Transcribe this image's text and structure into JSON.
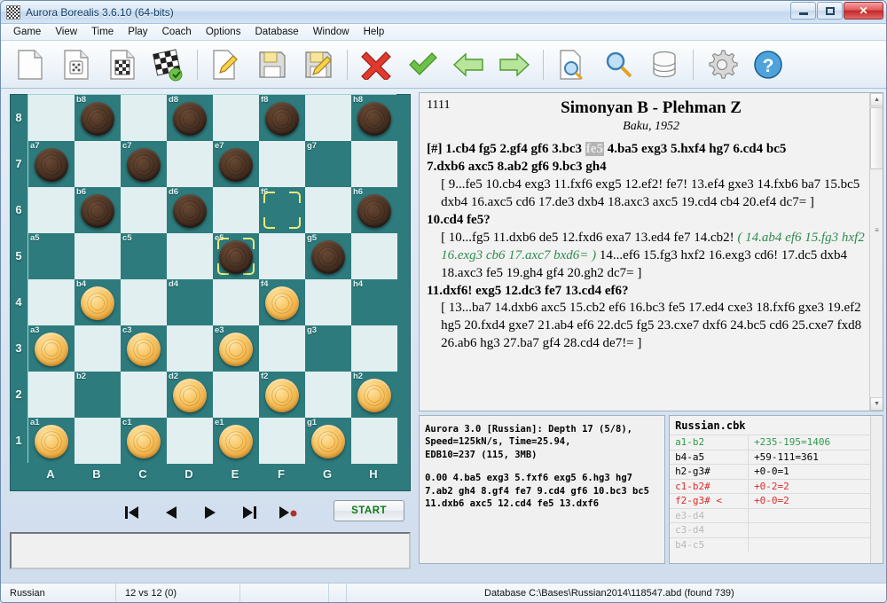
{
  "window": {
    "title": "Aurora Borealis 3.6.10 (64-bits)",
    "icon": "checkerboard-icon",
    "minimize": "minimize-icon",
    "maximize": "maximize-icon",
    "close": "✕"
  },
  "menu": [
    {
      "label": "Game"
    },
    {
      "label": "View"
    },
    {
      "label": "Time"
    },
    {
      "label": "Play"
    },
    {
      "label": "Coach"
    },
    {
      "label": "Options"
    },
    {
      "label": "Database"
    },
    {
      "label": "Window"
    },
    {
      "label": "Help"
    }
  ],
  "toolbar": [
    {
      "name": "new-document-icon",
      "title": "New"
    },
    {
      "name": "random-document-icon",
      "title": "Random"
    },
    {
      "name": "board-document-icon",
      "title": "New Board"
    },
    {
      "name": "setup-board-icon",
      "title": "Setup Position"
    },
    {
      "sep": true
    },
    {
      "name": "edit-document-icon",
      "title": "Edit"
    },
    {
      "name": "save-icon",
      "title": "Save"
    },
    {
      "name": "save-as-icon",
      "title": "Save As"
    },
    {
      "sep": true
    },
    {
      "name": "delete-icon",
      "title": "Delete"
    },
    {
      "name": "confirm-icon",
      "title": "Confirm"
    },
    {
      "name": "back-arrow-icon",
      "title": "Back"
    },
    {
      "name": "forward-arrow-icon",
      "title": "Forward"
    },
    {
      "sep": true
    },
    {
      "name": "search-document-icon",
      "title": "Search Document"
    },
    {
      "name": "search-icon",
      "title": "Search"
    },
    {
      "name": "database-icon",
      "title": "Database"
    },
    {
      "sep": true
    },
    {
      "name": "settings-gear-icon",
      "title": "Options"
    },
    {
      "name": "help-icon",
      "title": "Help"
    }
  ],
  "board": {
    "files": [
      "A",
      "B",
      "C",
      "D",
      "E",
      "F",
      "G",
      "H"
    ],
    "ranks": [
      "8",
      "7",
      "6",
      "5",
      "4",
      "3",
      "2",
      "1"
    ],
    "squares": [
      {
        "id": "a8",
        "dark": false,
        "piece": null,
        "label": false,
        "mark": false
      },
      {
        "id": "b8",
        "dark": true,
        "piece": "black",
        "label": true,
        "mark": false
      },
      {
        "id": "c8",
        "dark": false,
        "piece": null,
        "label": false,
        "mark": false
      },
      {
        "id": "d8",
        "dark": true,
        "piece": "black",
        "label": true,
        "mark": false
      },
      {
        "id": "e8",
        "dark": false,
        "piece": null,
        "label": false,
        "mark": false
      },
      {
        "id": "f8",
        "dark": true,
        "piece": "black",
        "label": true,
        "mark": false
      },
      {
        "id": "g8",
        "dark": false,
        "piece": null,
        "label": false,
        "mark": false
      },
      {
        "id": "h8",
        "dark": true,
        "piece": "black",
        "label": true,
        "mark": false
      },
      {
        "id": "a7",
        "dark": true,
        "piece": "black",
        "label": true,
        "mark": false
      },
      {
        "id": "b7",
        "dark": false,
        "piece": null,
        "label": false,
        "mark": false
      },
      {
        "id": "c7",
        "dark": true,
        "piece": "black",
        "label": true,
        "mark": false
      },
      {
        "id": "d7",
        "dark": false,
        "piece": null,
        "label": false,
        "mark": false
      },
      {
        "id": "e7",
        "dark": true,
        "piece": "black",
        "label": true,
        "mark": false
      },
      {
        "id": "f7",
        "dark": false,
        "piece": null,
        "label": false,
        "mark": false
      },
      {
        "id": "g7",
        "dark": true,
        "piece": null,
        "label": true,
        "mark": false
      },
      {
        "id": "h7",
        "dark": false,
        "piece": null,
        "label": false,
        "mark": false
      },
      {
        "id": "a6",
        "dark": false,
        "piece": null,
        "label": false,
        "mark": false
      },
      {
        "id": "b6",
        "dark": true,
        "piece": "black",
        "label": true,
        "mark": false
      },
      {
        "id": "c6",
        "dark": false,
        "piece": null,
        "label": false,
        "mark": false
      },
      {
        "id": "d6",
        "dark": true,
        "piece": "black",
        "label": true,
        "mark": false
      },
      {
        "id": "e6",
        "dark": false,
        "piece": null,
        "label": false,
        "mark": false
      },
      {
        "id": "f6",
        "dark": true,
        "piece": null,
        "label": true,
        "mark": true
      },
      {
        "id": "g6",
        "dark": false,
        "piece": null,
        "label": false,
        "mark": false
      },
      {
        "id": "h6",
        "dark": true,
        "piece": "black",
        "label": true,
        "mark": false
      },
      {
        "id": "a5",
        "dark": true,
        "piece": null,
        "label": true,
        "mark": false
      },
      {
        "id": "b5",
        "dark": false,
        "piece": null,
        "label": false,
        "mark": false
      },
      {
        "id": "c5",
        "dark": true,
        "piece": null,
        "label": true,
        "mark": false
      },
      {
        "id": "d5",
        "dark": false,
        "piece": null,
        "label": false,
        "mark": false
      },
      {
        "id": "e5",
        "dark": true,
        "piece": "black",
        "label": true,
        "mark": true
      },
      {
        "id": "f5",
        "dark": false,
        "piece": null,
        "label": false,
        "mark": false
      },
      {
        "id": "g5",
        "dark": true,
        "piece": "black",
        "label": true,
        "mark": false
      },
      {
        "id": "h5",
        "dark": false,
        "piece": null,
        "label": false,
        "mark": false
      },
      {
        "id": "a4",
        "dark": false,
        "piece": null,
        "label": false,
        "mark": false
      },
      {
        "id": "b4",
        "dark": true,
        "piece": "white",
        "label": true,
        "mark": false
      },
      {
        "id": "c4",
        "dark": false,
        "piece": null,
        "label": false,
        "mark": false
      },
      {
        "id": "d4",
        "dark": true,
        "piece": null,
        "label": true,
        "mark": false
      },
      {
        "id": "e4",
        "dark": false,
        "piece": null,
        "label": false,
        "mark": false
      },
      {
        "id": "f4",
        "dark": true,
        "piece": "white",
        "label": true,
        "mark": false
      },
      {
        "id": "g4",
        "dark": false,
        "piece": null,
        "label": false,
        "mark": false
      },
      {
        "id": "h4",
        "dark": true,
        "piece": null,
        "label": true,
        "mark": false
      },
      {
        "id": "a3",
        "dark": true,
        "piece": "white",
        "label": true,
        "mark": false
      },
      {
        "id": "b3",
        "dark": false,
        "piece": null,
        "label": false,
        "mark": false
      },
      {
        "id": "c3",
        "dark": true,
        "piece": "white",
        "label": true,
        "mark": false
      },
      {
        "id": "d3",
        "dark": false,
        "piece": null,
        "label": false,
        "mark": false
      },
      {
        "id": "e3",
        "dark": true,
        "piece": "white",
        "label": true,
        "mark": false
      },
      {
        "id": "f3",
        "dark": false,
        "piece": null,
        "label": false,
        "mark": false
      },
      {
        "id": "g3",
        "dark": true,
        "piece": null,
        "label": true,
        "mark": false
      },
      {
        "id": "h3",
        "dark": false,
        "piece": null,
        "label": false,
        "mark": false
      },
      {
        "id": "a2",
        "dark": false,
        "piece": null,
        "label": false,
        "mark": false
      },
      {
        "id": "b2",
        "dark": true,
        "piece": null,
        "label": true,
        "mark": false
      },
      {
        "id": "c2",
        "dark": false,
        "piece": null,
        "label": false,
        "mark": false
      },
      {
        "id": "d2",
        "dark": true,
        "piece": "white",
        "label": true,
        "mark": false
      },
      {
        "id": "e2",
        "dark": false,
        "piece": null,
        "label": false,
        "mark": false
      },
      {
        "id": "f2",
        "dark": true,
        "piece": "white",
        "label": true,
        "mark": false
      },
      {
        "id": "g2",
        "dark": false,
        "piece": null,
        "label": false,
        "mark": false
      },
      {
        "id": "h2",
        "dark": true,
        "piece": "white",
        "label": true,
        "mark": false
      },
      {
        "id": "a1",
        "dark": true,
        "piece": "white",
        "label": true,
        "mark": false
      },
      {
        "id": "b1",
        "dark": false,
        "piece": null,
        "label": false,
        "mark": false
      },
      {
        "id": "c1",
        "dark": true,
        "piece": "white",
        "label": true,
        "mark": false
      },
      {
        "id": "d1",
        "dark": false,
        "piece": null,
        "label": false,
        "mark": false
      },
      {
        "id": "e1",
        "dark": true,
        "piece": "white",
        "label": true,
        "mark": false
      },
      {
        "id": "f1",
        "dark": false,
        "piece": null,
        "label": false,
        "mark": false
      },
      {
        "id": "g1",
        "dark": true,
        "piece": "white",
        "label": true,
        "mark": false
      },
      {
        "id": "h1",
        "dark": false,
        "piece": null,
        "label": false,
        "mark": false
      }
    ]
  },
  "transport": {
    "first": "skip-to-start-icon",
    "prev": "step-back-icon",
    "next": "step-forward-icon",
    "last": "skip-to-end-icon",
    "play_to_end": "play-to-end-icon",
    "start_label": "START"
  },
  "notation": {
    "game_id": "1111",
    "title": "Simonyan B - Plehman Z",
    "subtitle": "Baku, 1952",
    "line1_pre": "[#] 1.cb4 fg5 2.gf4 gf6 3.bc3 ",
    "line1_hl": "fe5",
    "line1_post": " 4.ba5 exg3 5.hxf4 hg7 6.cd4 bc5",
    "line2": "7.dxb6 axc5 8.ab2 gf6 9.bc3 gh4",
    "var1": "[ 9...fe5 10.cb4 exg3 11.fxf6 exg5 12.ef2! fe7! 13.ef4 gxe3 14.fxb6 ba7 15.bc5 dxb4 16.axc5 cd6 17.de3 dxb4 18.axc3 axc5 19.cd4 cb4 20.ef4 dc7= ]",
    "line3": "10.cd4 fe5?",
    "var2_a": "[ 10...fg5 11.dxb6 de5 12.fxd6 exa7 13.ed4 fe7 14.cb2! ",
    "var2_green": "( 14.ab4 ef6 15.fg3 hxf2 16.exg3 cb6 17.axc7 bxd6= )",
    "var2_b": " 14...ef6 15.fg3 hxf2 16.exg3 cd6! 17.dc5 dxb4 18.axc3 fe5 19.gh4 gf4 20.gh2 dc7= ]",
    "line4": "11.dxf6! exg5 12.dc3 fe7 13.cd4 ef6?",
    "var3": "[ 13...ba7 14.dxb6 axc5 15.cb2 ef6 16.bc3 fe5 17.ed4 cxe3 18.fxf6 gxe3 19.ef2 hg5 20.fxd4 gxe7 21.ab4 ef6 22.dc5 fg5 23.cxe7 dxf6 24.bc5 cd6 25.cxe7 fxd8 26.ab6 hg3 27.ba7 gf4 28.cd4 de7!= ]"
  },
  "engine": {
    "line1": "Aurora 3.0 [Russian]: Depth 17 (5/8),",
    "line2": "Speed=125kN/s,  Time=25.94,",
    "line3": "EDB10=237 (115, 3MB)",
    "pv1": "0.00 4.ba5 exg3 5.fxf6 exg5 6.hg3 hg7",
    "pv2": "7.ab2 gh4 8.gf4 fe7 9.cd4 gf6 10.bc3 bc5",
    "pv3": "11.dxb6 axc5 12.cd4 fe5 13.dxf6"
  },
  "database": {
    "title": "Russian.cbk",
    "rows": [
      {
        "move": "a1-b2",
        "stat": "+235-195=1406",
        "color": "c-green",
        "sel": false
      },
      {
        "move": "b4-a5",
        "stat": "+59-111=361",
        "color": "c-black",
        "sel": false
      },
      {
        "move": "h2-g3#",
        "stat": "+0-0=1",
        "color": "c-black",
        "sel": false
      },
      {
        "move": "c1-b2#",
        "stat": "+0-2=2",
        "color": "c-red",
        "sel": false
      },
      {
        "move": "f2-g3#  <",
        "stat": "+0-0=2",
        "color": "c-red",
        "sel": true
      },
      {
        "move": "e3-d4",
        "stat": "",
        "color": "c-grey",
        "sel": false
      },
      {
        "move": "c3-d4",
        "stat": "",
        "color": "c-grey",
        "sel": false
      },
      {
        "move": "b4-c5",
        "stat": "",
        "color": "c-grey",
        "sel": false
      }
    ]
  },
  "statusbar": {
    "variant": "Russian",
    "material": "12 vs 12  (0)",
    "field3": "",
    "field4": "",
    "database": "Database C:\\Bases\\Russian2014\\118547.abd (found 739)"
  }
}
